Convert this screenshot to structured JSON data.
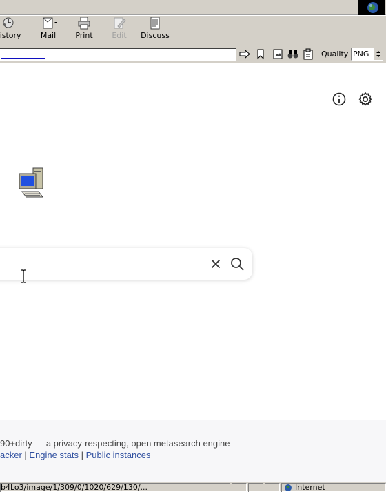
{
  "toolbar": {
    "history_label": "History",
    "mail_label": "Mail",
    "print_label": "Print",
    "edit_label": "Edit",
    "discuss_label": "Discuss"
  },
  "addressbar": {
    "url_value": "",
    "quality_label": "Quality",
    "quality_value": "PNG"
  },
  "page": {
    "footer_line1": "90+dirty — a privacy-respecting, open metasearch engine",
    "footer_links": [
      "acker",
      "Engine stats",
      "Public instances"
    ],
    "footer_sep": " | "
  },
  "statusbar": {
    "url_text": "b4Lo3/image/1/309/0/1020/629/130/...",
    "zone_label": "Internet"
  },
  "colors": {
    "chrome": "#d4d0c8",
    "link": "#3050a0"
  }
}
